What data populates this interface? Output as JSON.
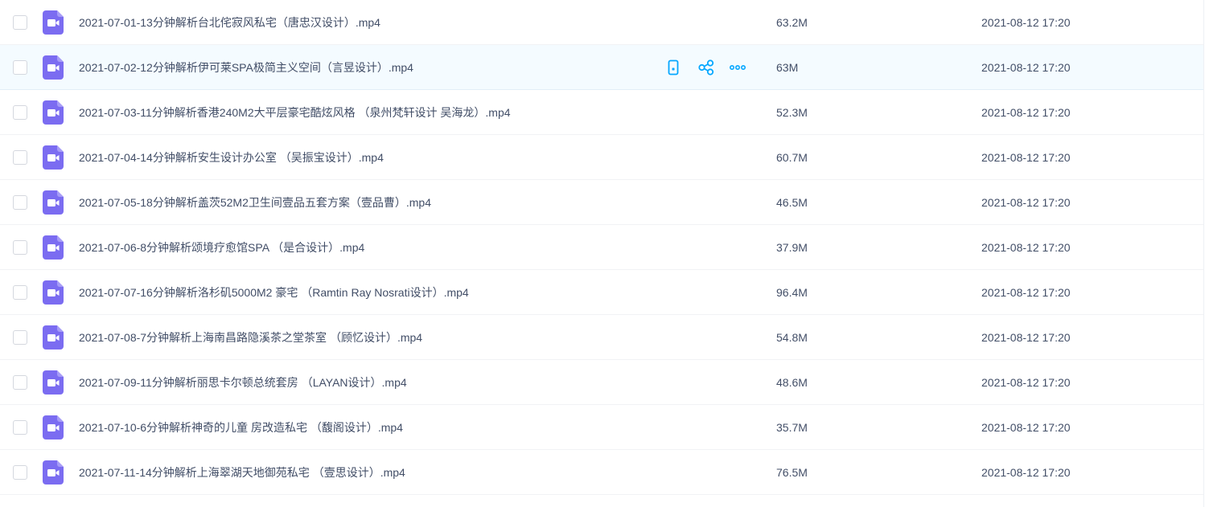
{
  "accent_color": "#06a7ff",
  "file_icon_color": "#7b6cf1",
  "row_actions": [
    {
      "icon": "phone-icon"
    },
    {
      "icon": "share-icon"
    },
    {
      "icon": "more-icon"
    }
  ],
  "files": [
    {
      "name": "2021-07-01-13分钟解析台北侘寂风私宅（唐忠汉设计）.mp4",
      "size": "63.2M",
      "modified": "2021-08-12 17:20"
    },
    {
      "name": "2021-07-02-12分钟解析伊可莱SPA极简主义空间（言昱设计）.mp4",
      "size": "63M",
      "modified": "2021-08-12 17:20"
    },
    {
      "name": "2021-07-03-11分钟解析香港240M2大平层豪宅酷炫风格 （泉州梵轩设计 吴海龙）.mp4",
      "size": "52.3M",
      "modified": "2021-08-12 17:20"
    },
    {
      "name": "2021-07-04-14分钟解析安生设计办公室 （吴振宝设计）.mp4",
      "size": "60.7M",
      "modified": "2021-08-12 17:20"
    },
    {
      "name": "2021-07-05-18分钟解析盖茨52M2卫生间壹品五套方案（壹品曹）.mp4",
      "size": "46.5M",
      "modified": "2021-08-12 17:20"
    },
    {
      "name": "2021-07-06-8分钟解析颂境疗愈馆SPA （是合设计）.mp4",
      "size": "37.9M",
      "modified": "2021-08-12 17:20"
    },
    {
      "name": "2021-07-07-16分钟解析洛杉矶5000M2 豪宅 （Ramtin Ray Nosrati设计）.mp4",
      "size": "96.4M",
      "modified": "2021-08-12 17:20"
    },
    {
      "name": "2021-07-08-7分钟解析上海南昌路隐溪茶之堂茶室 （顾忆设计）.mp4",
      "size": "54.8M",
      "modified": "2021-08-12 17:20"
    },
    {
      "name": "2021-07-09-11分钟解析丽思卡尔顿总统套房 （LAYAN设计）.mp4",
      "size": "48.6M",
      "modified": "2021-08-12 17:20"
    },
    {
      "name": "2021-07-10-6分钟解析神奇的儿童 房改造私宅 （馥阁设计）.mp4",
      "size": "35.7M",
      "modified": "2021-08-12 17:20"
    },
    {
      "name": "2021-07-11-14分钟解析上海翠湖天地御苑私宅 （壹思设计）.mp4",
      "size": "76.5M",
      "modified": "2021-08-12 17:20"
    }
  ]
}
